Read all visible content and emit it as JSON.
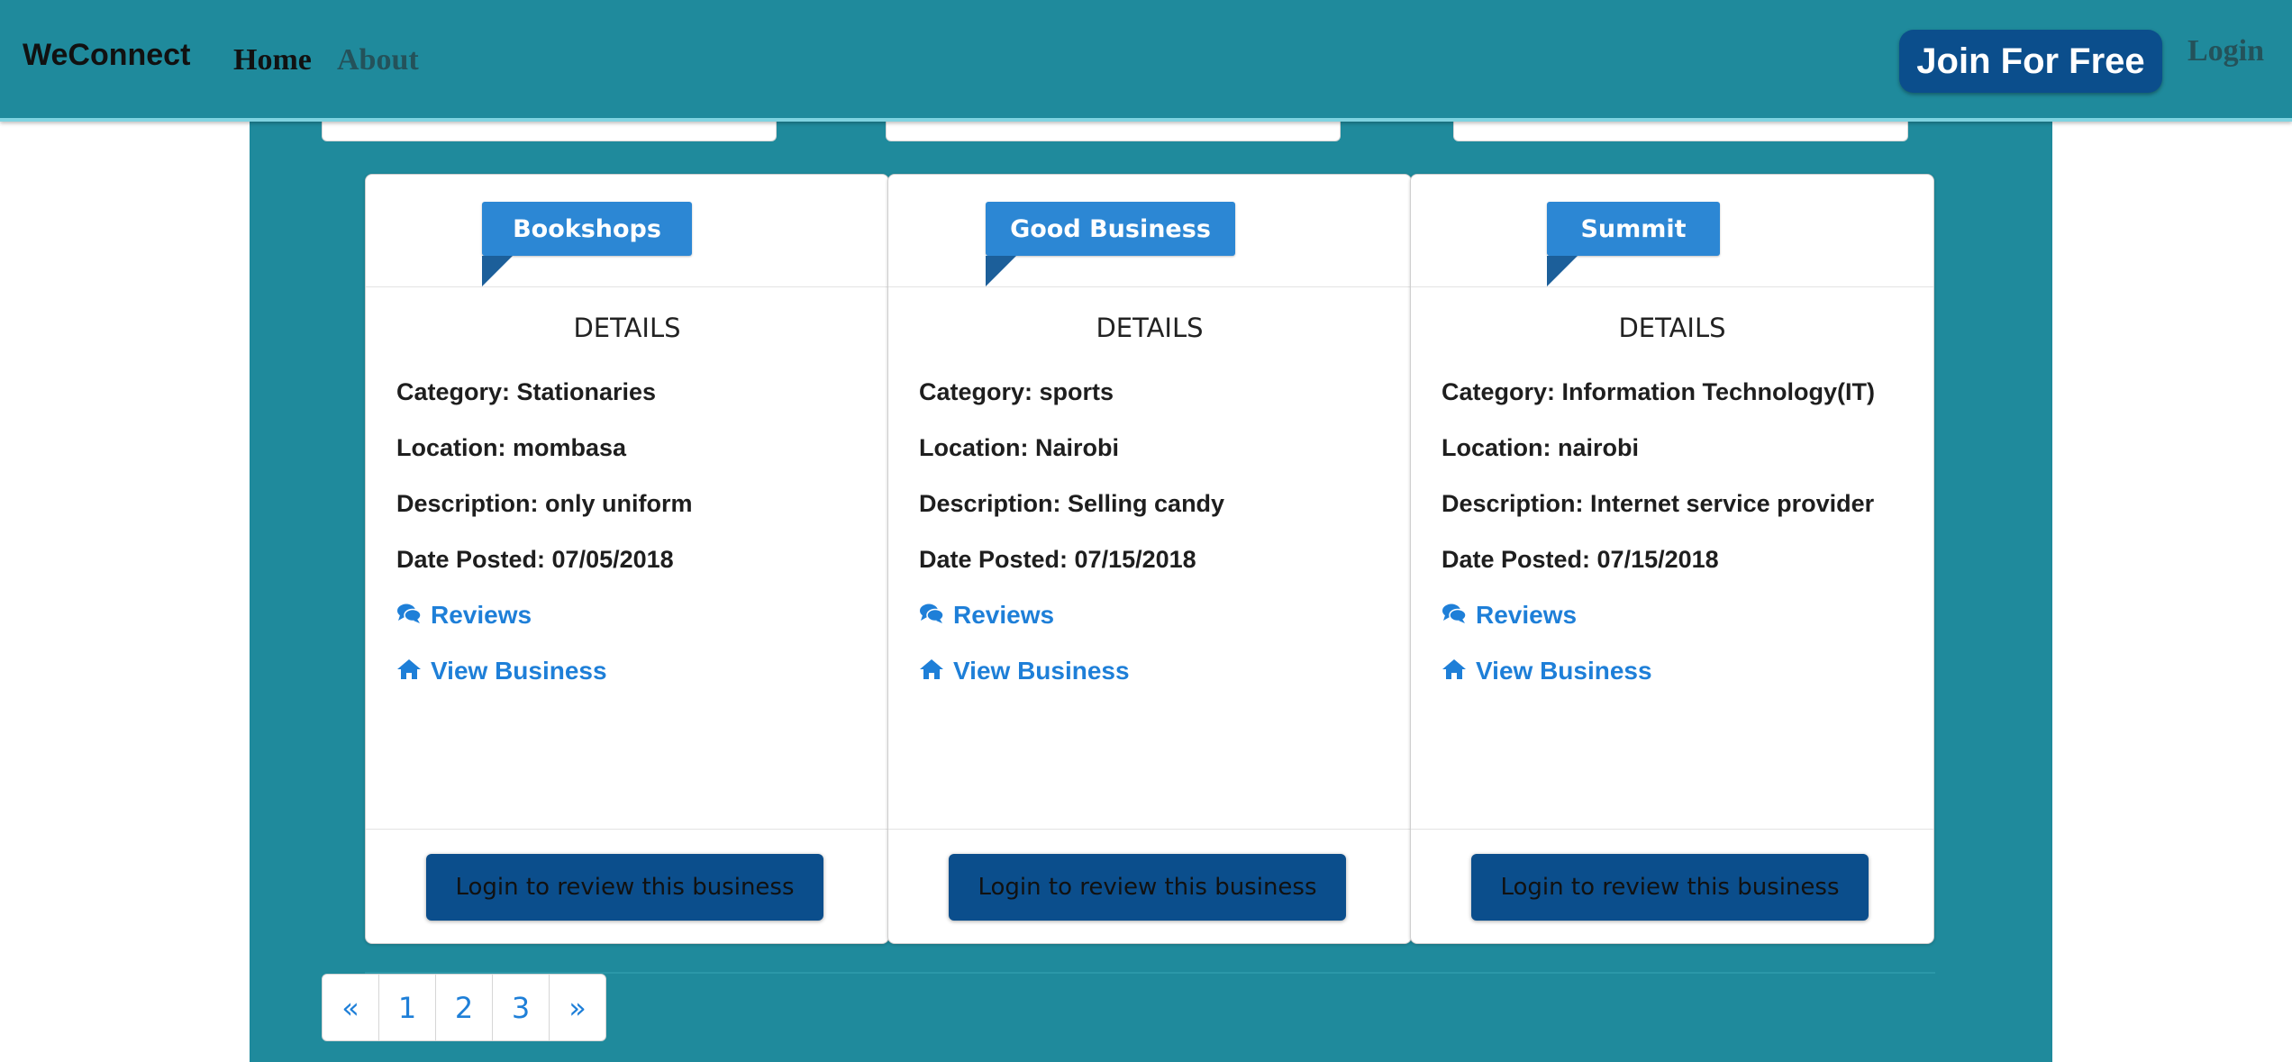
{
  "navbar": {
    "brand": "WeConnect",
    "links": [
      {
        "label": "Home"
      },
      {
        "label": "About"
      }
    ],
    "join_label": "Join For Free",
    "login_label": "Login"
  },
  "cards": [
    {
      "ribbon": "Bookshops",
      "details_title": "DETAILS",
      "category": "Category: Stationaries",
      "location": "Location: mombasa",
      "description": "Description: only uniform",
      "date_posted": "Date Posted: 07/05/2018",
      "reviews_label": "Reviews",
      "view_label": "View Business",
      "review_button": "Login to review this business"
    },
    {
      "ribbon": "Good Business",
      "details_title": "DETAILS",
      "category": "Category: sports",
      "location": "Location: Nairobi",
      "description": "Description: Selling candy",
      "date_posted": "Date Posted: 07/15/2018",
      "reviews_label": "Reviews",
      "view_label": "View Business",
      "review_button": "Login to review this business"
    },
    {
      "ribbon": "Summit",
      "details_title": "DETAILS",
      "category": "Category: Information Technology(IT)",
      "location": "Location: nairobi",
      "description": "Description: Internet service provider",
      "date_posted": "Date Posted: 07/15/2018",
      "reviews_label": "Reviews",
      "view_label": "View Business",
      "review_button": "Login to review this business"
    }
  ],
  "pagination": {
    "prev": "«",
    "pages": [
      "1",
      "2",
      "3"
    ],
    "next": "»"
  },
  "icons": {
    "reviews": "comments-icon",
    "view": "home-icon"
  },
  "colors": {
    "navbar_bg": "#1f8a9c",
    "button_bg": "#0b4e8c",
    "ribbon_bg": "#2c87d4",
    "link": "#1e7fd8"
  }
}
